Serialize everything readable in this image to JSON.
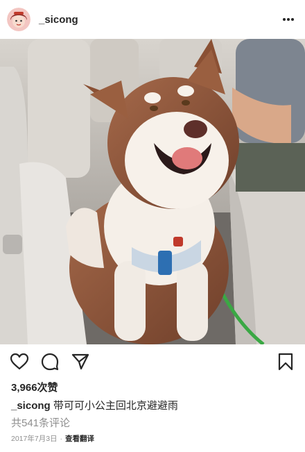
{
  "post": {
    "username": "_sicong",
    "likes": "3,966次赞",
    "caption_user": "_sicong",
    "caption_text": " 带可可小公主回北京避避雨",
    "comments": "共541条评论",
    "date": "2017年7月3日",
    "separator": "·",
    "translate": "查看翻译"
  },
  "icons": {
    "more": "more-dots-icon",
    "like": "heart-outline-icon",
    "comment": "comment-bubble-icon",
    "share": "send-arrow-icon",
    "save": "bookmark-outline-icon"
  },
  "colors": {
    "text": "#262626",
    "muted": "#8e8e8e",
    "avatar_bg": "#f3c6c2",
    "avatar_hair": "#8a2a24"
  }
}
